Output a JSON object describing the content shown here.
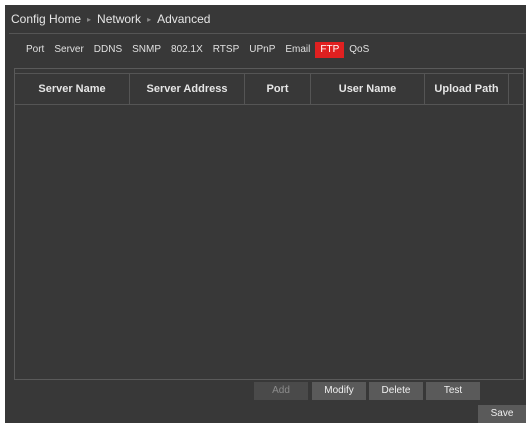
{
  "breadcrumb": {
    "items": [
      "Config Home",
      "Network",
      "Advanced"
    ],
    "separator": "▸"
  },
  "tabs": [
    {
      "label": "Port"
    },
    {
      "label": "Server"
    },
    {
      "label": "DDNS"
    },
    {
      "label": "SNMP"
    },
    {
      "label": "802.1X"
    },
    {
      "label": "RTSP"
    },
    {
      "label": "UPnP"
    },
    {
      "label": "Email"
    },
    {
      "label": "FTP",
      "active": true
    },
    {
      "label": "QoS"
    }
  ],
  "table": {
    "columns": [
      "Server Name",
      "Server Address",
      "Port",
      "User Name",
      "Upload Path"
    ],
    "rows": []
  },
  "buttons": {
    "add": "Add",
    "modify": "Modify",
    "delete": "Delete",
    "test": "Test",
    "save": "Save"
  },
  "colors": {
    "background": "#383838",
    "active_tab": "#e02020",
    "text": "#e6e6e6"
  }
}
